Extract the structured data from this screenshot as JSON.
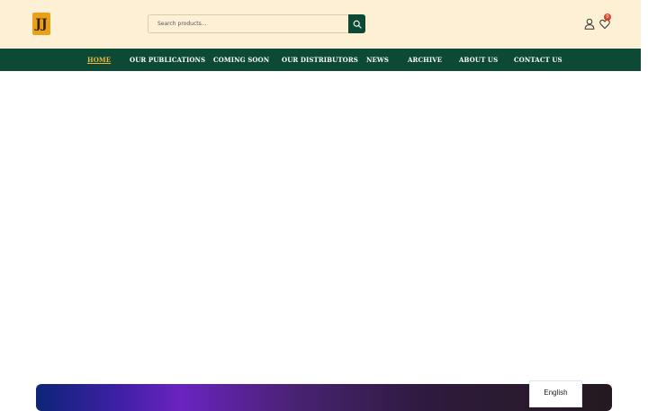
{
  "header": {
    "logo_text": "JJ",
    "search": {
      "placeholder": "Search products..."
    },
    "wishlist_count": "0"
  },
  "nav": {
    "items": [
      {
        "label": "HOME",
        "active": true
      },
      {
        "label": "OUR PUBLICATIONS"
      },
      {
        "label": "COMING SOON"
      },
      {
        "label": "OUR DISTRIBUTORS"
      },
      {
        "label": "NEWS"
      },
      {
        "label": "ARCHIVE"
      },
      {
        "label": "ABOUT US"
      },
      {
        "label": "CONTACT US"
      }
    ]
  },
  "language": {
    "selected": "English"
  },
  "colors": {
    "header_bg": "#fdf0d5",
    "nav_bg": "#0d4a36",
    "active_link": "#f3b53c",
    "badge": "#d9472b"
  },
  "icons": [
    "search-icon",
    "user-icon",
    "heart-icon"
  ]
}
